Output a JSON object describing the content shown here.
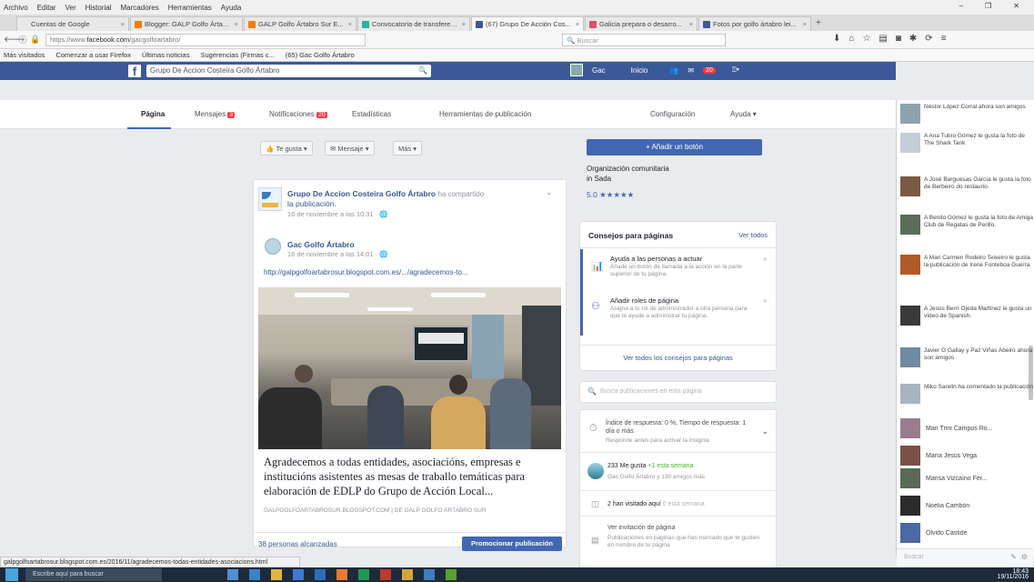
{
  "browser": {
    "menu": [
      "Archivo",
      "Editar",
      "Ver",
      "Historial",
      "Marcadores",
      "Herramientas",
      "Ayuda"
    ],
    "tabs": [
      {
        "label": "Cuentas de Google",
        "color": "#e8e8e8"
      },
      {
        "label": "Blogger: GALP Golfo Ártabro",
        "color": "#f57c00"
      },
      {
        "label": "GALP Golfo Ártabro Sur E...",
        "color": "#f57c00"
      },
      {
        "label": "Convocatoria de transferencia...",
        "color": "#1fb7a6"
      },
      {
        "label": "(67) Grupo De Acción Cos...",
        "color": "#3b5998"
      },
      {
        "label": "Galicia prepara o desarro...",
        "color": "#e04f6d"
      },
      {
        "label": "Fotos por golfo ártabro lei...",
        "color": "#3b5998"
      }
    ],
    "url_prefix": "https://www.",
    "url_domain": "facebook.com",
    "url_suffix": "/gacgolfoartabro/",
    "search_placeholder": "Buscar",
    "bookmarks": [
      "Más visitados",
      "Comenzar a usar Firefox",
      "Últimas noticias",
      "Sugerencias (Firmas c...",
      "(65) Gac Golfo Ártabro"
    ]
  },
  "facebook": {
    "search_value": "Grupo De Accion Costeira Golfo Ártabro",
    "user": "Gac",
    "home": "Inicio",
    "notif_count": "20",
    "page_tabs": {
      "page": "Página",
      "messages": "Mensajes",
      "messages_badge": "3",
      "notifications": "Notificaciones",
      "notif_badge": "20",
      "stats": "Estadísticas",
      "tools": "Herramientas de publicación",
      "settings": "Configuración",
      "help": "Ayuda"
    },
    "actions": {
      "like": "Te gusta",
      "message": "Mensaje",
      "more": "Más"
    },
    "post": {
      "author": "Grupo De Accion Costeira Golfo Ártabro",
      "shared": "ha compartido",
      "shared2": "la publicación.",
      "time": "16 de noviembre a las 10:31",
      "orig_author": "Gac Golfo Ártabro",
      "orig_time": "16 de noviembre a las 14:01",
      "link": "http://galpgolfoartabrosur.blogspot.com.es/.../agradecemos-to...",
      "title": "Agradecemos a todas entidades, asociacións, empresas e institucións asistentes as mesas de traballo temáticas para elaboración de EDLP do Grupo de Acción Local...",
      "source": "GALPGOLFOARTABROSUR.BLOGSPOT.COM | DE GALP GOLFO ÁRTABRO SUR",
      "reach": "38 personas alcanzadas",
      "promote": "Promocionar publicación"
    },
    "right": {
      "add_button": "+ Añadir un botón",
      "org_type": "Organización comunitaria",
      "org_place": "in Sada",
      "rating": "5.0 ★★★★★",
      "tips_title": "Consejos para páginas",
      "tips_link": "Ver todos",
      "tip1_title": "Ayuda a las personas a actuar",
      "tip1_text": "Añade un botón de llamada a la acción en la parte superior de tu página.",
      "tip2_title": "Añadir roles de página",
      "tip2_text": "Asigna a tu rol de administrador a otra persona para que te ayude a administrar tu página.",
      "tips_all": "Ver todos los consejos para páginas",
      "search_placeholder": "Busca publicaciones en esta página",
      "resp_text": "Índice de respuesta: 0 %, Tiempo de respuesta: 1 día o más",
      "resp_sub": "Responde antes para activar la insignia",
      "likes_text": "233 Me gusta",
      "likes_week": "+1 esta semana",
      "likes_sub": "Gac Golfo Ártabro y 130 amigos más",
      "visits": "2 han visitado aquí",
      "vis_week": "0 esta semana",
      "recommend_title": "Ver invitación de página",
      "recommend_text": "Publicaciones en páginas que has marcado que te gusten en nombre de tu página"
    },
    "chat": [
      {
        "text": "Néstor López Corral ahora son amigos",
        "color": "#8fa2b0"
      },
      {
        "text": "A Ana Tubío Gómez le gusta la foto de The Shark Tank",
        "color": "#c5cdd6"
      },
      {
        "text": "A José Barguesas García le gusta la foto de Berbeiro do restaurio.",
        "color": "#7a5a45"
      },
      {
        "text": "A Benito Gómez le gusta la foto de Amiga Club de Regatas de Perillo.",
        "color": "#5b6c5a"
      },
      {
        "text": "A Mari Carmen Rodeiro Teixeiro le gusta la publicación de Irene Fonteboa Guerra.",
        "color": "#b05a2a"
      },
      {
        "text": "A Jesús Berrí Ojeda Martínez le gusta un vídeo de Spanish.",
        "color": "#3a3a3a"
      },
      {
        "text": "Javier G Gallay y Paz Viñas Abeiro ahora son amigos",
        "color": "#6f8aa1"
      },
      {
        "text": "Miko Sarelin ha comentado la publicación",
        "color": "#a8b4bf"
      }
    ],
    "contacts": [
      {
        "name": "Mari Trini Campos Ro...",
        "color": "#9a7c90"
      },
      {
        "name": "María Jesús Vega",
        "color": "#7a5048"
      },
      {
        "name": "Marisa Vizcaíno Fer...",
        "color": "#5a6a55"
      },
      {
        "name": "Noelia Cambón",
        "color": "#2b2b2b"
      },
      {
        "name": "Olvido Castide",
        "color": "#4a6aa0"
      }
    ],
    "chat_search": "Buscar"
  },
  "status_url": "galpgolfoartabrosur.blogspot.com.es/2016/11/agradecemos-todas-entidades-asociacions.html",
  "taskbar": {
    "search": "Escribe aquí para buscar",
    "time": "18:43",
    "date": "19/11/2016"
  }
}
